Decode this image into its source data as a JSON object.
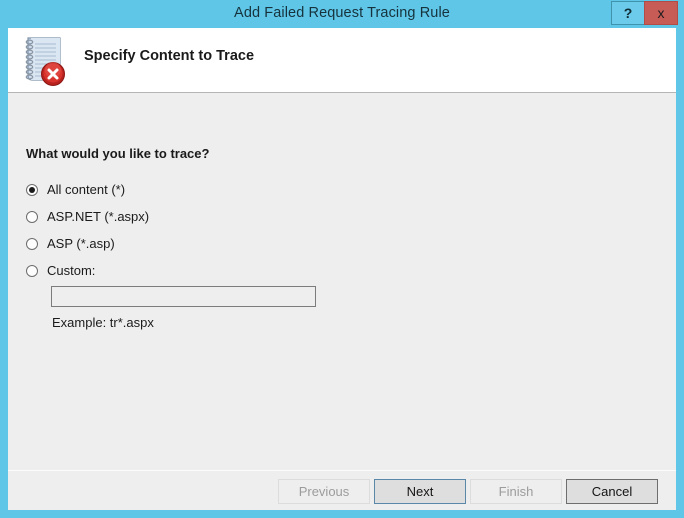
{
  "window": {
    "title": "Add Failed Request Tracing Rule",
    "accent_blue": "#5fc6e8",
    "close_red": "#c75b56",
    "content_bg": "#efeeee"
  },
  "titlebar_buttons": {
    "help_label": "?",
    "close_label": "x"
  },
  "header": {
    "title": "Specify Content to Trace",
    "icon": "document-error-icon"
  },
  "content": {
    "question": "What would you like to trace?",
    "options": [
      {
        "label": "All content (*)",
        "checked": true,
        "name": "all-content"
      },
      {
        "label": "ASP.NET (*.aspx)",
        "checked": false,
        "name": "asp-net"
      },
      {
        "label": "ASP (*.asp)",
        "checked": false,
        "name": "asp"
      },
      {
        "label": "Custom:",
        "checked": false,
        "name": "custom"
      }
    ],
    "custom_input": {
      "value": "",
      "placeholder": ""
    },
    "example_text": "Example: tr*.aspx"
  },
  "buttons": {
    "previous": "Previous",
    "next": "Next",
    "finish": "Finish",
    "cancel": "Cancel"
  }
}
